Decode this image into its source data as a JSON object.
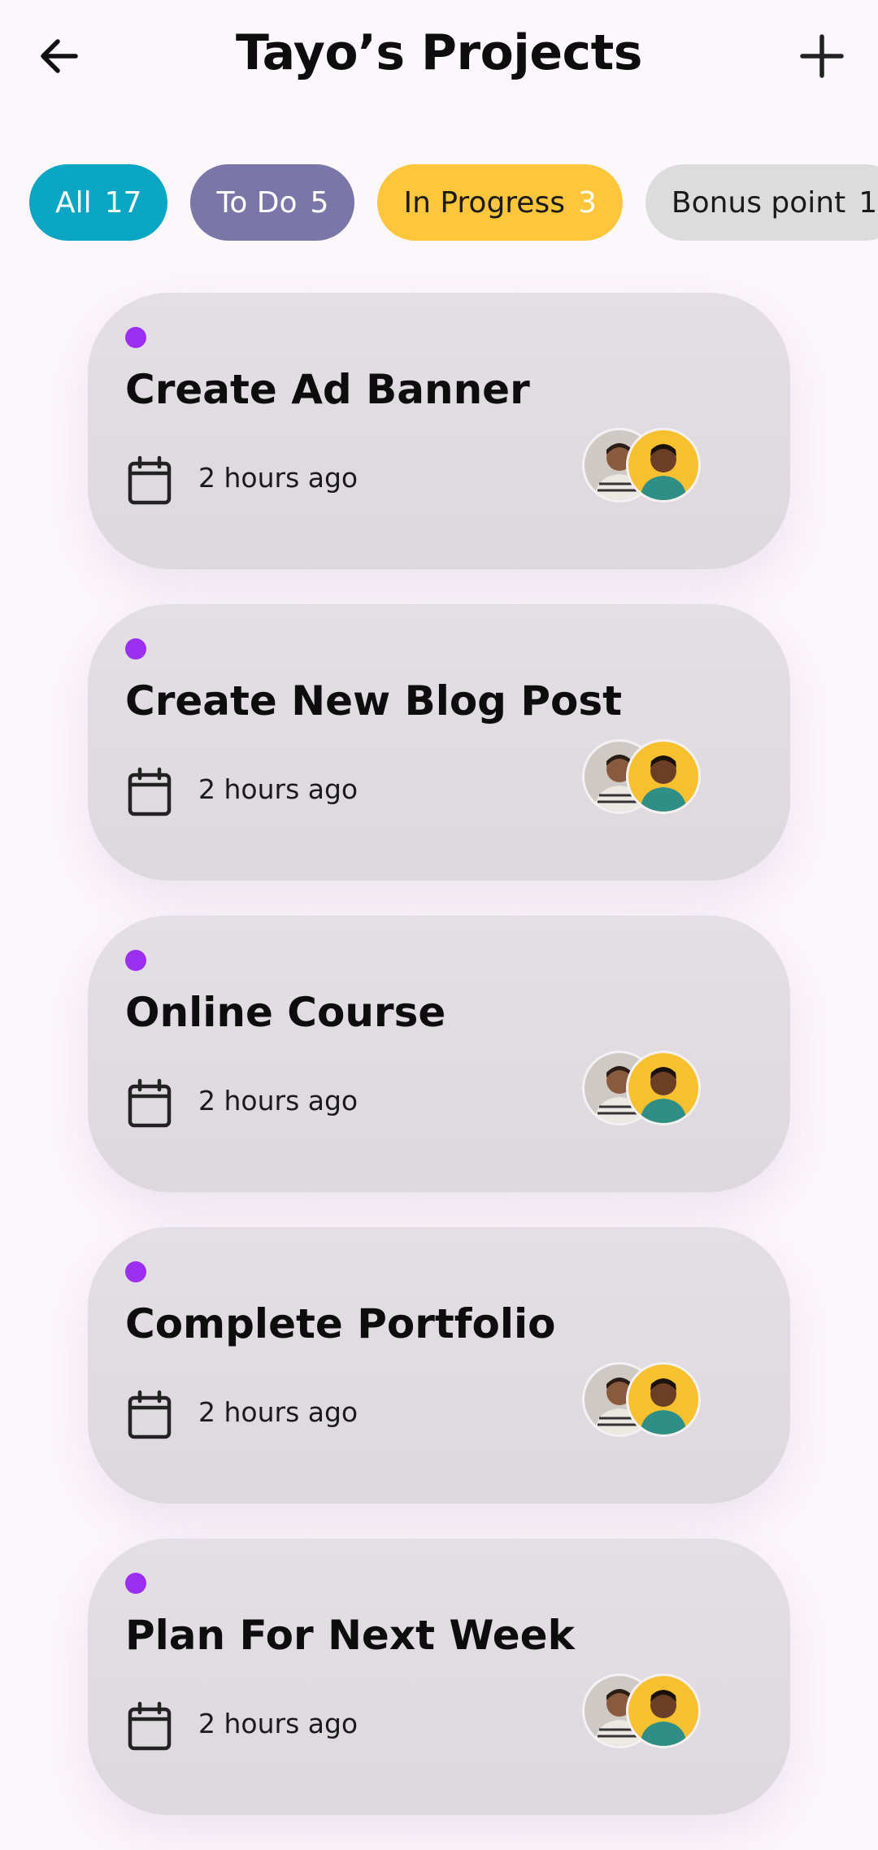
{
  "header": {
    "title": "Tayo’s Projects",
    "back_icon": "arrow-left-icon",
    "add_icon": "plus-icon"
  },
  "filters": [
    {
      "label": "All",
      "count": "17",
      "bg": "#0ba6c3",
      "fg": "#ffffff",
      "count_fg": "#ffffff"
    },
    {
      "label": "To Do",
      "count": "5",
      "bg": "#7b76a8",
      "fg": "#ffffff",
      "count_fg": "#ffffff"
    },
    {
      "label": "In Progress",
      "count": "3",
      "bg": "#ffc63b",
      "fg": "#1a1a1a",
      "count_fg": "#ffffff"
    },
    {
      "label": "Bonus point",
      "count": "1",
      "bg": "#dcdcdc",
      "fg": "#1a1a1a",
      "count_fg": "#1a1a1a"
    }
  ],
  "tasks": [
    {
      "title": "Create Ad Banner",
      "time": "2 hours ago"
    },
    {
      "title": "Create New Blog Post",
      "time": "2 hours ago"
    },
    {
      "title": "Online Course",
      "time": "2 hours ago"
    },
    {
      "title": "Complete Portfolio",
      "time": "2 hours ago"
    },
    {
      "title": "Plan For Next Week",
      "time": "2 hours ago"
    }
  ],
  "colors": {
    "accent_dot": "#9b2ff0",
    "background": "#fcf7fc",
    "card": "#dedadf"
  }
}
